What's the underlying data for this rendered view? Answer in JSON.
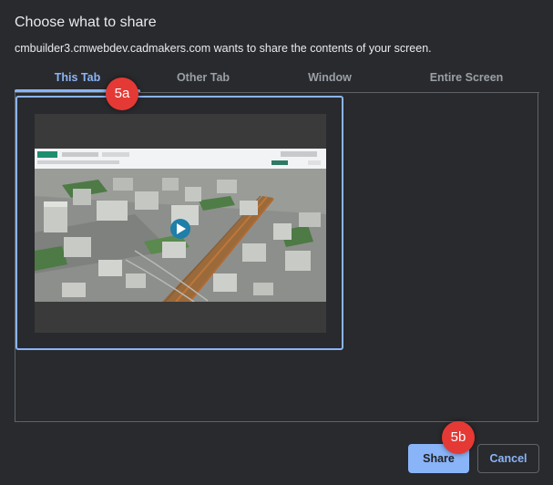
{
  "dialog": {
    "title": "Choose what to share",
    "subtitle": "cmbuilder3.cmwebdev.cadmakers.com wants to share the contents of your screen."
  },
  "tabs": [
    {
      "label": "This Tab",
      "active": true
    },
    {
      "label": "Other Tab",
      "active": false
    },
    {
      "label": "Window",
      "active": false
    },
    {
      "label": "Entire Screen",
      "active": false
    }
  ],
  "thumbnail": {
    "app_logo": "cmbuilder",
    "has_play_button": true
  },
  "callouts": {
    "tab_marker": "5a",
    "share_marker": "5b"
  },
  "buttons": {
    "share": "Share",
    "cancel": "Cancel"
  },
  "colors": {
    "accent": "#8ab4f8",
    "callout": "#e53935",
    "background": "#292a2d"
  }
}
